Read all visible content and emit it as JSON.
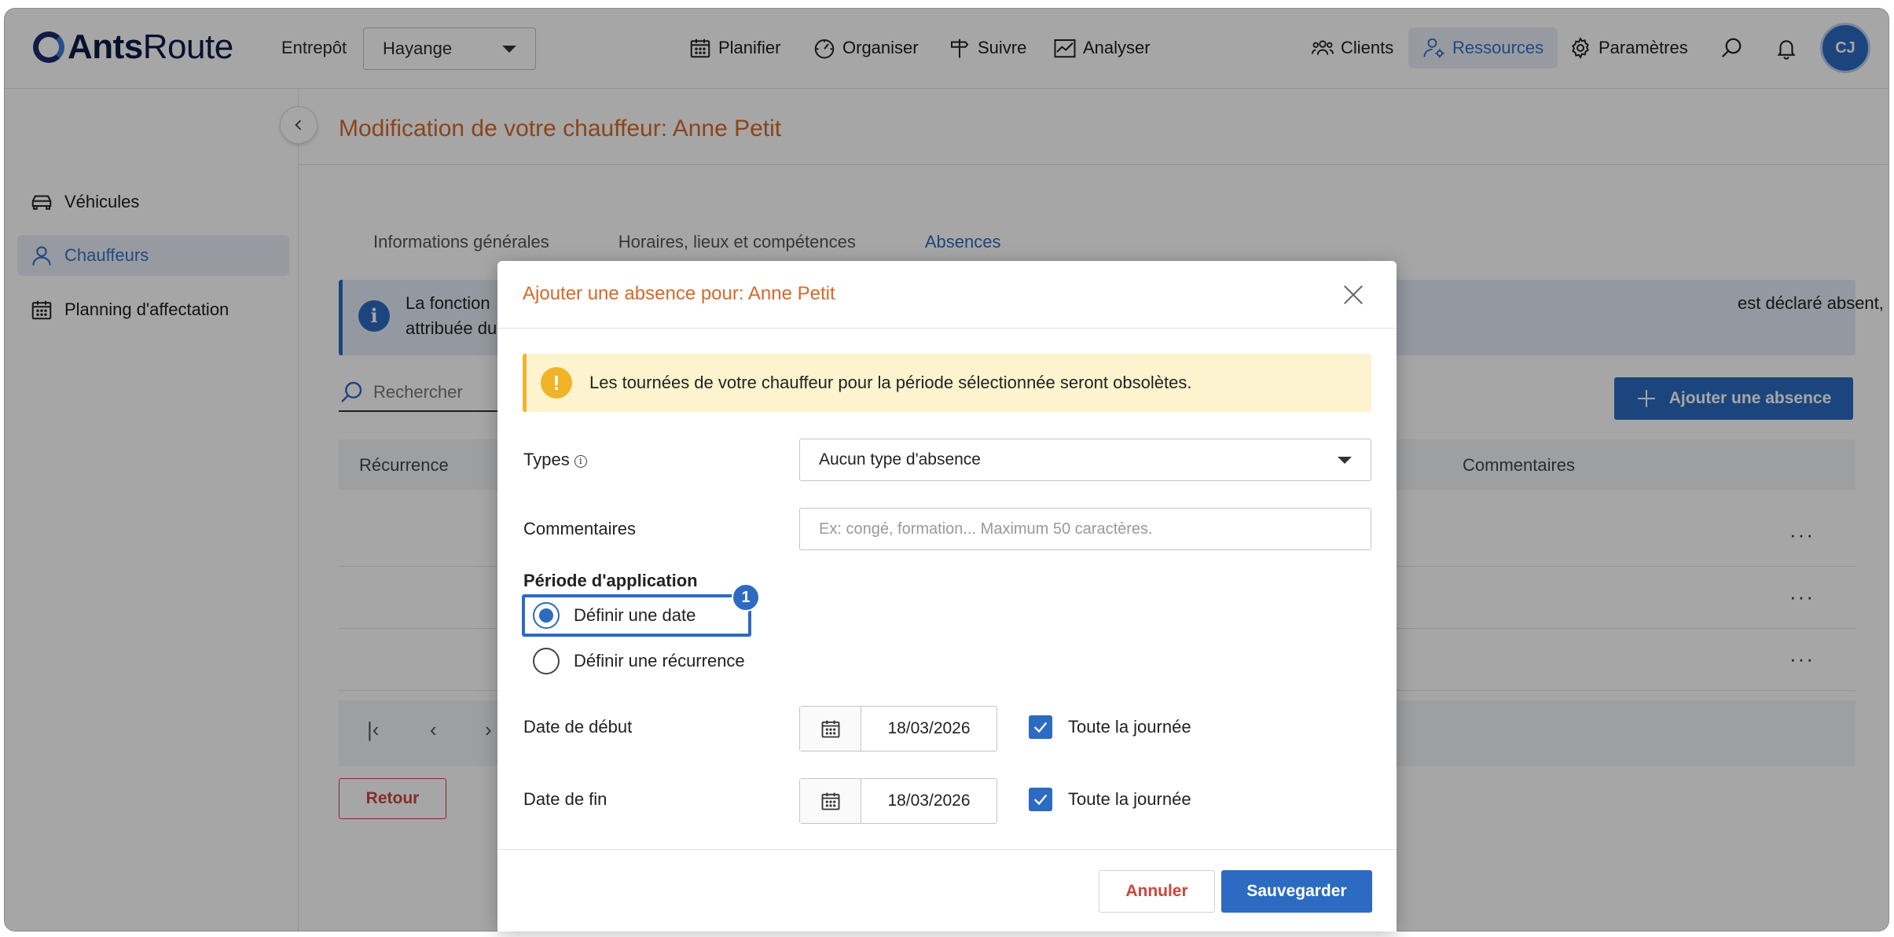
{
  "header": {
    "logo_bold": "Ants",
    "logo_regular": "Route",
    "warehouse_label": "Entrepôt",
    "warehouse_value": "Hayange",
    "nav": [
      {
        "label": "Planifier",
        "icon": "calendar-icon"
      },
      {
        "label": "Organiser",
        "icon": "gauge-icon"
      },
      {
        "label": "Suivre",
        "icon": "signpost-icon"
      },
      {
        "label": "Analyser",
        "icon": "chart-icon"
      }
    ],
    "right_nav": [
      {
        "label": "Clients",
        "icon": "users-icon"
      },
      {
        "label": "Ressources",
        "icon": "user-gear-icon",
        "active": true
      },
      {
        "label": "Paramètres",
        "icon": "gear-icon"
      }
    ],
    "avatar_initials": "CJ"
  },
  "sidebar": {
    "items": [
      {
        "label": "Véhicules",
        "icon": "car-icon"
      },
      {
        "label": "Chauffeurs",
        "icon": "user-icon",
        "active": true
      },
      {
        "label": "Planning d'affectation",
        "icon": "calendar-icon"
      }
    ]
  },
  "main": {
    "title": "Modification de votre chauffeur: Anne Petit",
    "tabs": [
      {
        "label": "Informations générales"
      },
      {
        "label": "Horaires, lieux et compétences"
      },
      {
        "label": "Absences",
        "active": true
      }
    ],
    "info_banner_left_1": "La fonction",
    "info_banner_left_2": "attribuée du",
    "info_banner_right": "est déclaré absent, aucune livraison ne lui est",
    "search_placeholder": "Rechercher",
    "add_button": "Ajouter une absence",
    "table_headers": [
      "Récurrence",
      "Commentaires"
    ],
    "row_menu": "···",
    "back_button": "Retour"
  },
  "modal": {
    "title": "Ajouter une absence pour: Anne Petit",
    "warning": "Les tournées de votre chauffeur pour la période sélectionnée seront obsolètes.",
    "types_label": "Types",
    "types_value": "Aucun type d'absence",
    "comments_label": "Commentaires",
    "comments_placeholder": "Ex: congé, formation... Maximum 50 caractères.",
    "period_title": "Période d'application",
    "radio_date": "Définir une date",
    "radio_recurrence": "Définir une récurrence",
    "step_badge": "1",
    "start_label": "Date de début",
    "start_value": "18/03/2026",
    "end_label": "Date de fin",
    "end_value": "18/03/2026",
    "all_day_label": "Toute la journée",
    "cancel_button": "Annuler",
    "save_button": "Sauvegarder"
  },
  "colors": {
    "accent": "#2c6bc1",
    "title_orange": "#d46a2a",
    "danger": "#c9463d",
    "warning_bg": "#fdf3cf"
  }
}
